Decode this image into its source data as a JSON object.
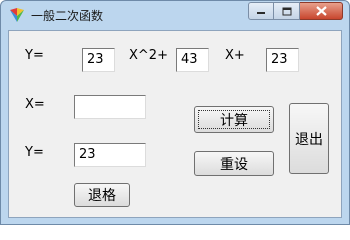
{
  "window": {
    "title": "一般二次函数"
  },
  "row1": {
    "y_label": "Y=",
    "a_value": "23",
    "x2_label": "X^2+",
    "b_value": "43",
    "x_plus_label": "X+",
    "c_value": "23"
  },
  "x_field": {
    "label": "X=",
    "value": ""
  },
  "y_field": {
    "label": "Y=",
    "value": "23"
  },
  "buttons": {
    "compute": "计算",
    "reset": "重设",
    "exit": "退出",
    "backspace": "退格"
  }
}
